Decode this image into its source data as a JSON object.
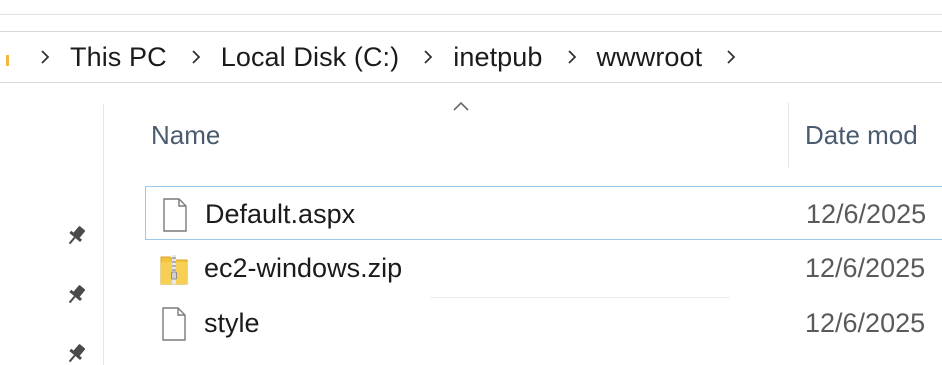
{
  "breadcrumb": {
    "items": [
      {
        "label": "This PC"
      },
      {
        "label": "Local Disk (C:)"
      },
      {
        "label": "inetpub"
      },
      {
        "label": "wwwroot"
      }
    ]
  },
  "columns": {
    "name": "Name",
    "date_modified": "Date mod"
  },
  "files": [
    {
      "name": "Default.aspx",
      "date": "12/6/2025",
      "icon": "file-icon",
      "selected": true
    },
    {
      "name": "ec2-windows.zip",
      "date": "12/6/2025",
      "icon": "zip-folder-icon",
      "selected": false
    },
    {
      "name": "style",
      "date": "12/6/2025",
      "icon": "file-icon",
      "selected": false
    }
  ],
  "colors": {
    "selection_border": "#99c9ef",
    "header_text": "#4a5b70",
    "folder_yellow": "#f3c23f"
  }
}
